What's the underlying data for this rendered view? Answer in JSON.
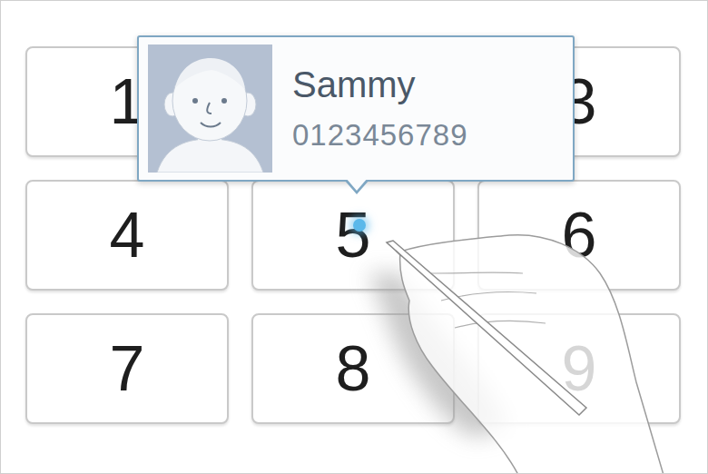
{
  "keys": [
    {
      "label": "1",
      "hovered": false
    },
    {
      "label": "",
      "hovered": false
    },
    {
      "label": "3",
      "hovered": false
    },
    {
      "label": "4",
      "hovered": false
    },
    {
      "label": "5",
      "hovered": true
    },
    {
      "label": "6",
      "hovered": false
    },
    {
      "label": "7",
      "hovered": false
    },
    {
      "label": "8",
      "hovered": false
    },
    {
      "label": "9",
      "hovered": false
    }
  ],
  "tooltip": {
    "name": "Sammy",
    "number": "0123456789"
  }
}
